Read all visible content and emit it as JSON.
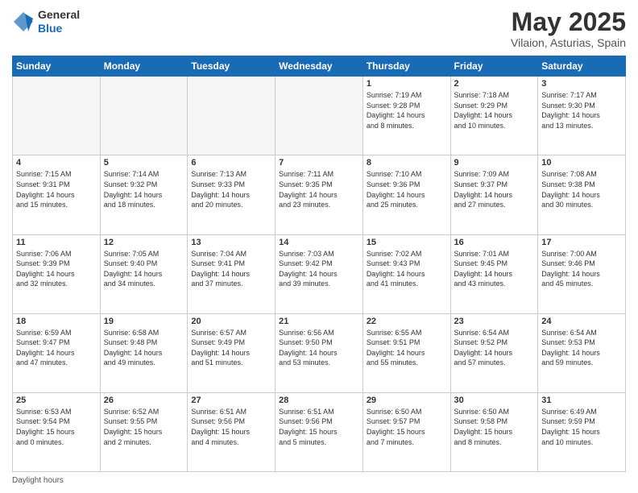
{
  "header": {
    "logo_general": "General",
    "logo_blue": "Blue",
    "month_title": "May 2025",
    "location": "Vilaion, Asturias, Spain"
  },
  "days_of_week": [
    "Sunday",
    "Monday",
    "Tuesday",
    "Wednesday",
    "Thursday",
    "Friday",
    "Saturday"
  ],
  "weeks": [
    [
      {
        "day": "",
        "info": ""
      },
      {
        "day": "",
        "info": ""
      },
      {
        "day": "",
        "info": ""
      },
      {
        "day": "",
        "info": ""
      },
      {
        "day": "1",
        "info": "Sunrise: 7:19 AM\nSunset: 9:28 PM\nDaylight: 14 hours\nand 8 minutes."
      },
      {
        "day": "2",
        "info": "Sunrise: 7:18 AM\nSunset: 9:29 PM\nDaylight: 14 hours\nand 10 minutes."
      },
      {
        "day": "3",
        "info": "Sunrise: 7:17 AM\nSunset: 9:30 PM\nDaylight: 14 hours\nand 13 minutes."
      }
    ],
    [
      {
        "day": "4",
        "info": "Sunrise: 7:15 AM\nSunset: 9:31 PM\nDaylight: 14 hours\nand 15 minutes."
      },
      {
        "day": "5",
        "info": "Sunrise: 7:14 AM\nSunset: 9:32 PM\nDaylight: 14 hours\nand 18 minutes."
      },
      {
        "day": "6",
        "info": "Sunrise: 7:13 AM\nSunset: 9:33 PM\nDaylight: 14 hours\nand 20 minutes."
      },
      {
        "day": "7",
        "info": "Sunrise: 7:11 AM\nSunset: 9:35 PM\nDaylight: 14 hours\nand 23 minutes."
      },
      {
        "day": "8",
        "info": "Sunrise: 7:10 AM\nSunset: 9:36 PM\nDaylight: 14 hours\nand 25 minutes."
      },
      {
        "day": "9",
        "info": "Sunrise: 7:09 AM\nSunset: 9:37 PM\nDaylight: 14 hours\nand 27 minutes."
      },
      {
        "day": "10",
        "info": "Sunrise: 7:08 AM\nSunset: 9:38 PM\nDaylight: 14 hours\nand 30 minutes."
      }
    ],
    [
      {
        "day": "11",
        "info": "Sunrise: 7:06 AM\nSunset: 9:39 PM\nDaylight: 14 hours\nand 32 minutes."
      },
      {
        "day": "12",
        "info": "Sunrise: 7:05 AM\nSunset: 9:40 PM\nDaylight: 14 hours\nand 34 minutes."
      },
      {
        "day": "13",
        "info": "Sunrise: 7:04 AM\nSunset: 9:41 PM\nDaylight: 14 hours\nand 37 minutes."
      },
      {
        "day": "14",
        "info": "Sunrise: 7:03 AM\nSunset: 9:42 PM\nDaylight: 14 hours\nand 39 minutes."
      },
      {
        "day": "15",
        "info": "Sunrise: 7:02 AM\nSunset: 9:43 PM\nDaylight: 14 hours\nand 41 minutes."
      },
      {
        "day": "16",
        "info": "Sunrise: 7:01 AM\nSunset: 9:45 PM\nDaylight: 14 hours\nand 43 minutes."
      },
      {
        "day": "17",
        "info": "Sunrise: 7:00 AM\nSunset: 9:46 PM\nDaylight: 14 hours\nand 45 minutes."
      }
    ],
    [
      {
        "day": "18",
        "info": "Sunrise: 6:59 AM\nSunset: 9:47 PM\nDaylight: 14 hours\nand 47 minutes."
      },
      {
        "day": "19",
        "info": "Sunrise: 6:58 AM\nSunset: 9:48 PM\nDaylight: 14 hours\nand 49 minutes."
      },
      {
        "day": "20",
        "info": "Sunrise: 6:57 AM\nSunset: 9:49 PM\nDaylight: 14 hours\nand 51 minutes."
      },
      {
        "day": "21",
        "info": "Sunrise: 6:56 AM\nSunset: 9:50 PM\nDaylight: 14 hours\nand 53 minutes."
      },
      {
        "day": "22",
        "info": "Sunrise: 6:55 AM\nSunset: 9:51 PM\nDaylight: 14 hours\nand 55 minutes."
      },
      {
        "day": "23",
        "info": "Sunrise: 6:54 AM\nSunset: 9:52 PM\nDaylight: 14 hours\nand 57 minutes."
      },
      {
        "day": "24",
        "info": "Sunrise: 6:54 AM\nSunset: 9:53 PM\nDaylight: 14 hours\nand 59 minutes."
      }
    ],
    [
      {
        "day": "25",
        "info": "Sunrise: 6:53 AM\nSunset: 9:54 PM\nDaylight: 15 hours\nand 0 minutes."
      },
      {
        "day": "26",
        "info": "Sunrise: 6:52 AM\nSunset: 9:55 PM\nDaylight: 15 hours\nand 2 minutes."
      },
      {
        "day": "27",
        "info": "Sunrise: 6:51 AM\nSunset: 9:56 PM\nDaylight: 15 hours\nand 4 minutes."
      },
      {
        "day": "28",
        "info": "Sunrise: 6:51 AM\nSunset: 9:56 PM\nDaylight: 15 hours\nand 5 minutes."
      },
      {
        "day": "29",
        "info": "Sunrise: 6:50 AM\nSunset: 9:57 PM\nDaylight: 15 hours\nand 7 minutes."
      },
      {
        "day": "30",
        "info": "Sunrise: 6:50 AM\nSunset: 9:58 PM\nDaylight: 15 hours\nand 8 minutes."
      },
      {
        "day": "31",
        "info": "Sunrise: 6:49 AM\nSunset: 9:59 PM\nDaylight: 15 hours\nand 10 minutes."
      }
    ]
  ],
  "footer": {
    "label": "Daylight hours"
  }
}
